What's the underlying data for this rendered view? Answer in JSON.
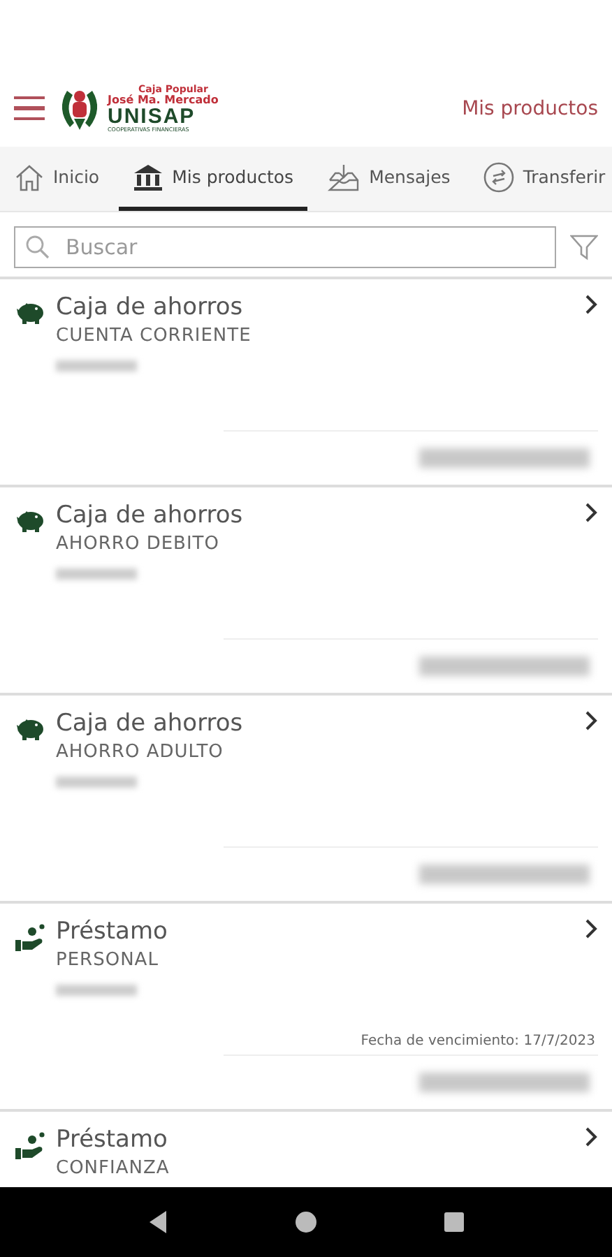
{
  "header": {
    "logo": {
      "line_1": "Caja Popular",
      "line_2": "José Ma. Mercado",
      "brand": "UNISAP",
      "tagline": "COOPERATIVAS FINANCIERAS"
    },
    "title": "Mis productos"
  },
  "tabs": [
    {
      "label": "Inicio",
      "selected": false
    },
    {
      "label": "Mis productos",
      "selected": true
    },
    {
      "label": "Mensajes",
      "selected": false
    },
    {
      "label": "Transferir",
      "selected": false
    }
  ],
  "search": {
    "placeholder": "Buscar"
  },
  "products": [
    {
      "kind": "savings",
      "title": "Caja de ahorros",
      "subtitle": "CUENTA CORRIENTE"
    },
    {
      "kind": "savings",
      "title": "Caja de ahorros",
      "subtitle": "AHORRO DEBITO"
    },
    {
      "kind": "savings",
      "title": "Caja de ahorros",
      "subtitle": "AHORRO ADULTO"
    },
    {
      "kind": "loan",
      "title": "Préstamo",
      "subtitle": "PERSONAL",
      "due_date": "Fecha de vencimiento: 17/7/2023"
    },
    {
      "kind": "loan",
      "title": "Préstamo",
      "subtitle": "CONFIANZA"
    }
  ]
}
